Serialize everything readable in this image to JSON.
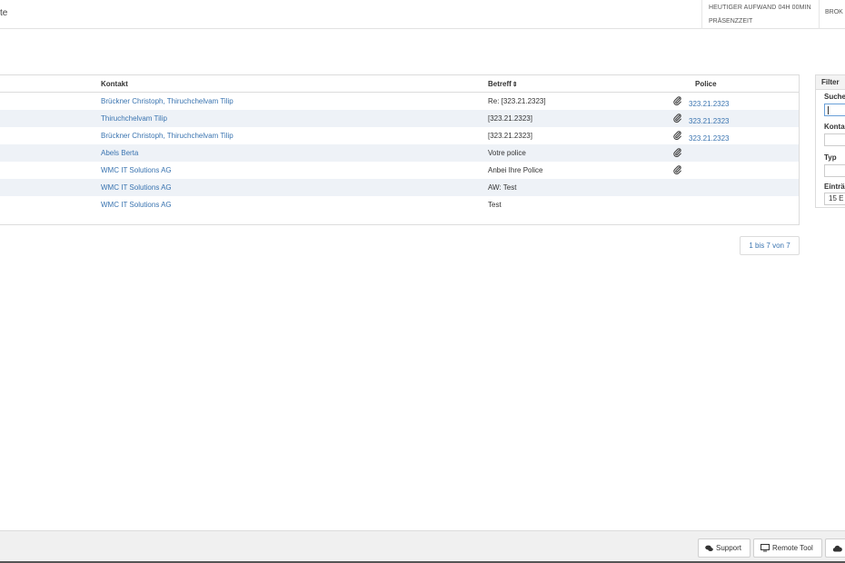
{
  "topbar": {
    "title": "te",
    "aufwand_line1": "HEUTIGER AUFWAND 04H 00MIN",
    "aufwand_line2": "PRÄSENZZEIT",
    "broker": "BROK"
  },
  "table": {
    "headers": {
      "kontakt": "Kontakt",
      "betreff": "Betreff",
      "police": "Police"
    },
    "rows": [
      {
        "kontakt": "Brückner Christoph, Thiruchchelvam Tilip",
        "betreff": "Re: [323.21.2323]",
        "attachment": true,
        "police": "323.21.2323"
      },
      {
        "kontakt": "Thiruchchelvam Tilip",
        "betreff": "[323.21.2323]",
        "attachment": true,
        "police": "323.21.2323"
      },
      {
        "kontakt": "Brückner Christoph, Thiruchchelvam Tilip",
        "betreff": "[323.21.2323]",
        "attachment": true,
        "police": "323.21.2323"
      },
      {
        "kontakt": "Abels Berta",
        "betreff": "Votre police",
        "attachment": true,
        "police": ""
      },
      {
        "kontakt": "WMC IT Solutions AG",
        "betreff": "Anbei Ihre Police",
        "attachment": true,
        "police": ""
      },
      {
        "kontakt": "WMC IT Solutions AG",
        "betreff": "AW: Test",
        "attachment": false,
        "police": ""
      },
      {
        "kontakt": "WMC IT Solutions AG",
        "betreff": "Test",
        "attachment": false,
        "police": ""
      }
    ],
    "pagination": "1 bis 7 von 7"
  },
  "filter": {
    "title": "Filter",
    "suche_label": "Suche",
    "kontakt_label": "Konta",
    "typ_label": "Typ",
    "eintraege_label": "Einträ",
    "eintraege_value": "15 E"
  },
  "footer": {
    "support_label": "Support",
    "remote_label": "Remote Tool"
  },
  "colors": {
    "link": "#3a74b0",
    "row_alt": "#eef2f7",
    "border": "#dcdcdc"
  }
}
